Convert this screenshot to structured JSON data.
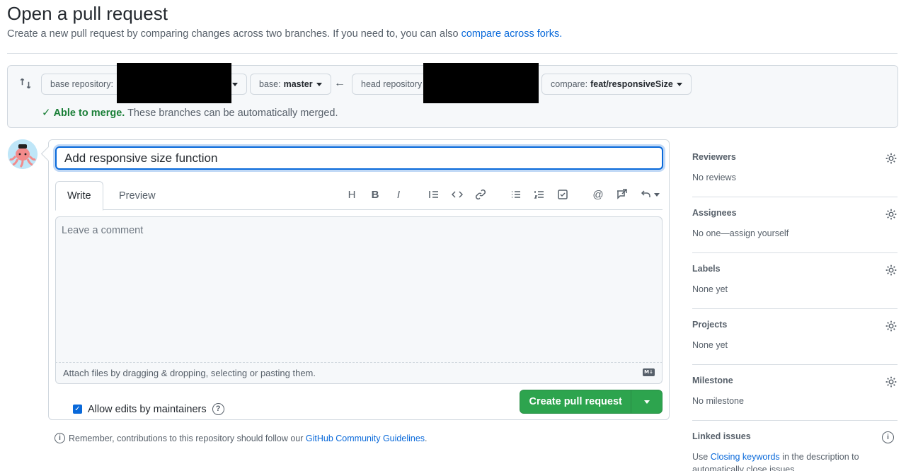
{
  "header": {
    "title": "Open a pull request",
    "subtitle": "Create a new pull request by comparing changes across two branches. If you need to, you can also",
    "subtitle_link": "compare across forks."
  },
  "compare": {
    "base_repo_label": "base repository:",
    "base_label": "base:",
    "base_branch": "master",
    "head_repo_label": "head repository",
    "compare_label": "compare:",
    "compare_branch": "feat/responsiveSize",
    "merge_status": "Able to merge.",
    "merge_detail": "These branches can be automatically merged."
  },
  "form": {
    "title_value": "Add responsive size function",
    "tabs": [
      "Write",
      "Preview"
    ],
    "comment_placeholder": "Leave a comment",
    "attach_text": "Attach files by dragging & dropping, selecting or pasting them.",
    "allow_edits_label": "Allow edits by maintainers",
    "create_button": "Create pull request"
  },
  "guidelines": {
    "prefix": "Remember, contributions to this repository should follow our",
    "link": "GitHub Community Guidelines",
    "suffix": "."
  },
  "sidebar": {
    "reviewers": {
      "title": "Reviewers",
      "value": "No reviews"
    },
    "assignees": {
      "title": "Assignees",
      "value": "No one—assign yourself"
    },
    "labels": {
      "title": "Labels",
      "value": "None yet"
    },
    "projects": {
      "title": "Projects",
      "value": "None yet"
    },
    "milestone": {
      "title": "Milestone",
      "value": "No milestone"
    },
    "linked": {
      "title": "Linked issues",
      "value_prefix": "Use",
      "value_link": "Closing keywords",
      "value_suffix": "in the description to automatically close issues"
    }
  },
  "colors": {
    "accent": "#0969da",
    "success": "#2da44e",
    "merge_ok": "#1a7f37"
  },
  "icons": {
    "compare": "git-compare-icon",
    "arrow": "arrow-left-icon",
    "gear": "gear-icon"
  }
}
